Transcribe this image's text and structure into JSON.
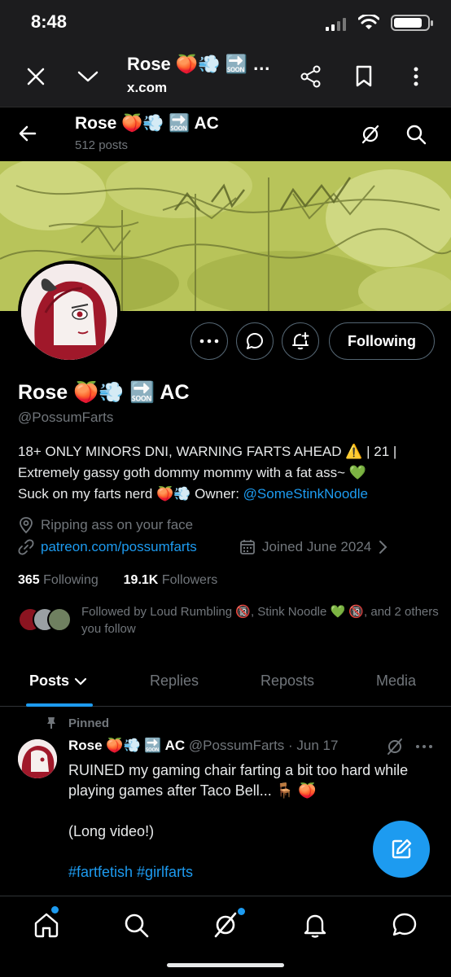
{
  "status_bar": {
    "time": "8:48"
  },
  "browser": {
    "title": "Rose 🍑💨 🔜 …",
    "url": "x.com"
  },
  "header": {
    "name": "Rose 🍑💨 🔜 AC",
    "post_count": "512 posts"
  },
  "actions": {
    "follow_label": "Following"
  },
  "profile": {
    "display_name": "Rose 🍑💨 🔜 AC",
    "handle": "@PossumFarts",
    "bio_line1": "18+ ONLY MINORS DNI, WARNING FARTS AHEAD ⚠️ | 21 |",
    "bio_line2": "Extremely gassy goth dommy mommy with a fat ass~ 💚",
    "bio_line3_pre": "Suck on my farts nerd 🍑💨 Owner: ",
    "bio_owner_link": "@SomeStinkNoodle",
    "location": "Ripping ass on your face",
    "website": "patreon.com/possumfarts",
    "joined": "Joined June 2024",
    "following_count": "365",
    "following_label": "Following",
    "followers_count": "19.1K",
    "followers_label": "Followers",
    "followed_by": "Followed by Loud Rumbling 🔞, Stink Noodle 💚 🔞, and 2 others you follow"
  },
  "tabs": [
    {
      "label": "Posts"
    },
    {
      "label": "Replies"
    },
    {
      "label": "Reposts"
    },
    {
      "label": "Media"
    }
  ],
  "pinned_post": {
    "pinned_label": "Pinned",
    "author": "Rose 🍑💨 🔜 AC",
    "handle": "@PossumFarts",
    "date": "· Jun 17",
    "line1": "RUINED my gaming chair farting a bit too hard while",
    "line2": "playing games after Taco Bell... 🪑 🍑",
    "line3": "(Long video!)",
    "hashtags": "#fartfetish #girlfarts"
  },
  "colors": {
    "accent": "#1d9bf0",
    "muted": "#71767b",
    "background": "#000000",
    "banner": "#b5c257"
  }
}
